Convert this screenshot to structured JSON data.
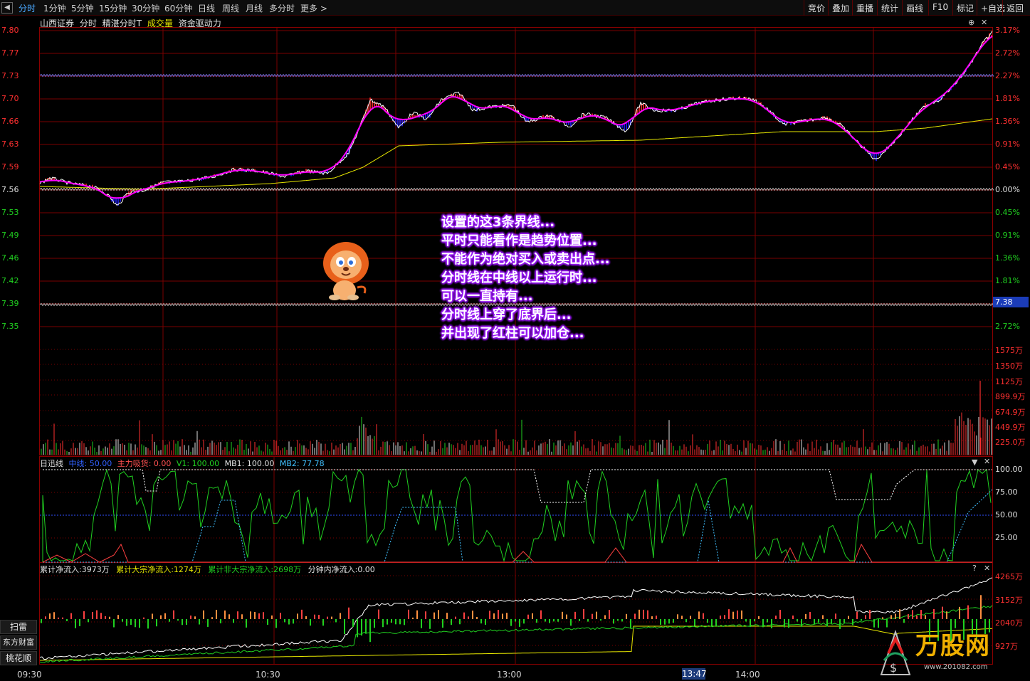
{
  "toolbar": {
    "back_icon": "chevron-left-icon",
    "periods": [
      "分时",
      "1分钟",
      "5分钟",
      "15分钟",
      "30分钟",
      "60分钟",
      "日线",
      "周线",
      "月线",
      "多分时",
      "更多 >"
    ],
    "right_buttons": [
      "竞价",
      "叠加",
      "重播",
      "统计",
      "画线",
      "F10",
      "标记",
      "+自选",
      "返回"
    ]
  },
  "info": {
    "broker": "山西证券",
    "mode": "分时",
    "indicator": "精湛分时T",
    "volume_label": "成交量",
    "flow_label": "资金驱动力"
  },
  "price_axis": {
    "left": [
      "7.80",
      "7.77",
      "7.73",
      "7.70",
      "7.66",
      "7.63",
      "7.59",
      "7.56",
      "7.53",
      "7.49",
      "7.46",
      "7.42",
      "7.39",
      "7.35"
    ],
    "right": [
      "3.17%",
      "2.72%",
      "2.27%",
      "1.81%",
      "1.36%",
      "0.91%",
      "0.45%",
      "0.00%",
      "0.45%",
      "0.91%",
      "1.36%",
      "1.81%",
      "",
      "2.72%"
    ],
    "current_price": "7.38"
  },
  "volume_axis": [
    "1575万",
    "1350万",
    "1125万",
    "899.9万",
    "674.9万",
    "449.9万",
    "225.0万"
  ],
  "osc_panel": {
    "name": "日迅线",
    "mid": "中线: 50.00",
    "main": "主力吸货: 0.00",
    "v1": "V1: 100.00",
    "mb1": "MB1: 100.00",
    "mb2": "MB2: 77.78",
    "axis": [
      "100.00",
      "75.00",
      "50.00",
      "25.00"
    ]
  },
  "flow_panel": {
    "total": "累计净流入:3973万",
    "big": "累计大宗净流入:1274万",
    "nonbig": "累计非大宗净流入:2698万",
    "minute": "分钟内净流入:0.00",
    "axis": [
      "4265万",
      "3152万",
      "2040万",
      "927万"
    ]
  },
  "side_buttons": [
    "扫雷",
    "东方财富",
    "桃花顺"
  ],
  "time_axis": [
    "09:30",
    "10:30",
    "13:00",
    "14:00"
  ],
  "cursor_time": "13:47",
  "annotation": [
    "设置的这3条界线...",
    "平时只能看作是趋势位置...",
    "不能作为绝对买入或卖出点...",
    "分时线在中线以上运行时...",
    "可以一直持有...",
    "分时线上穿了底界后...",
    "并出现了红柱可以加仓..."
  ],
  "watermark": {
    "brand": "万股网",
    "url": "www.201082.com"
  },
  "colors": {
    "up": "#ff3030",
    "down": "#2020ff",
    "grid": "#7a0000",
    "price_line": "#ffffff",
    "avg_line": "#ff00ff",
    "yellow": "#e8e800",
    "green": "#20d020",
    "accent": "#4aa8ff"
  }
}
